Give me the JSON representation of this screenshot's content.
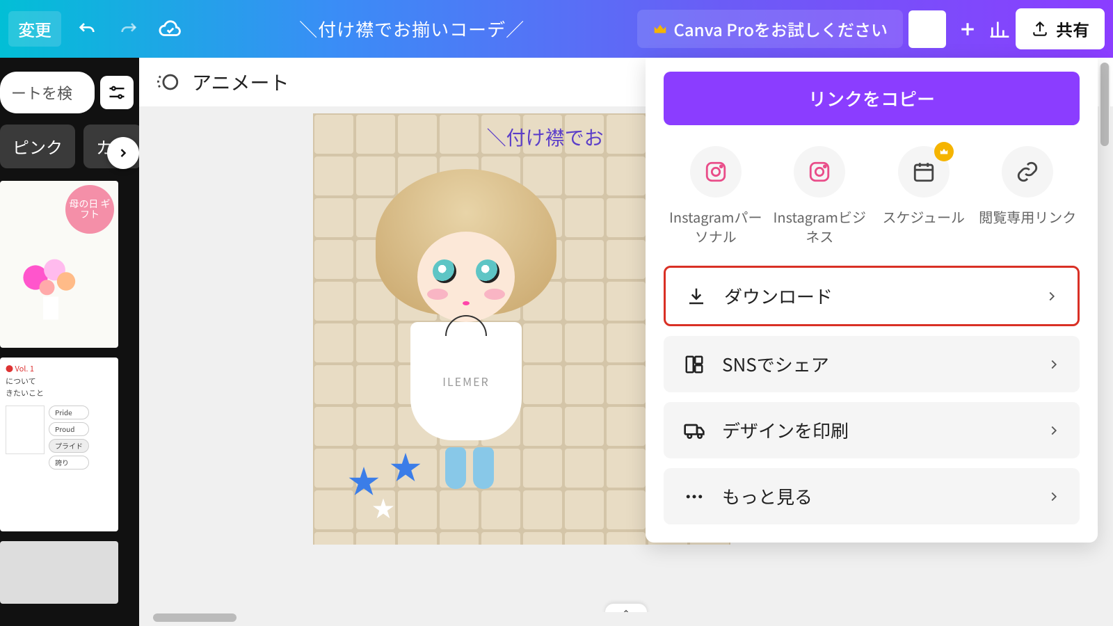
{
  "topbar": {
    "resize_label": "変更",
    "title": "＼付け襟でお揃いコーデ／",
    "pro_label": "Canva Proをお試しください",
    "share_label": "共有"
  },
  "sidebar": {
    "search_placeholder": "ートを検",
    "chips": [
      "ピンク",
      "カレ"
    ],
    "template_badge": "母の日\nギフト"
  },
  "contextbar": {
    "animate_label": "アニメート"
  },
  "canvas": {
    "headline": "＼付け襟でお",
    "doll_text": "ILEMER"
  },
  "share_panel": {
    "copy_link": "リンクをコピー",
    "targets": [
      {
        "label": "Instagramパーソナル",
        "icon": "instagram"
      },
      {
        "label": "Instagramビジネス",
        "icon": "instagram"
      },
      {
        "label": "スケジュール",
        "icon": "calendar",
        "pro": true
      },
      {
        "label": "閲覧専用リンク",
        "icon": "link"
      }
    ],
    "actions": [
      {
        "label": "ダウンロード",
        "icon": "download",
        "highlighted": true
      },
      {
        "label": "SNSでシェア",
        "icon": "grid"
      },
      {
        "label": "デザインを印刷",
        "icon": "truck"
      },
      {
        "label": "もっと見る",
        "icon": "dots"
      }
    ]
  }
}
